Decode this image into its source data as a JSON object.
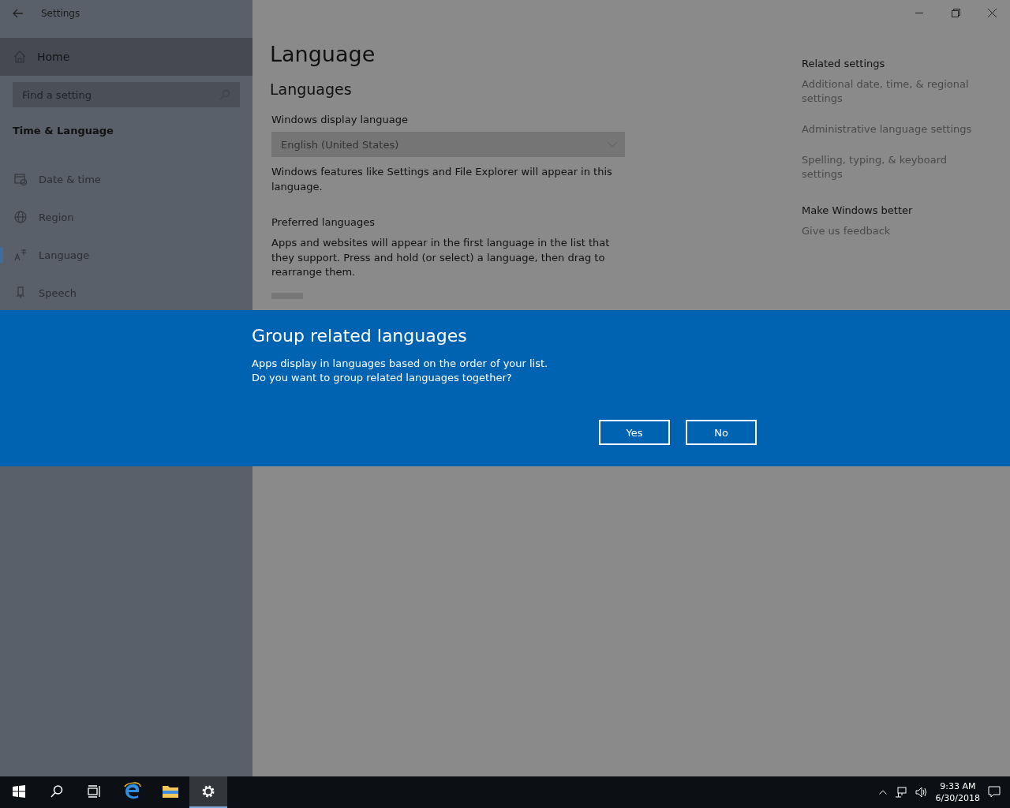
{
  "window": {
    "title": "Settings"
  },
  "sidebar": {
    "home": "Home",
    "search": {
      "placeholder": "Find a setting"
    },
    "section": "Time & Language",
    "items": [
      {
        "label": "Date & time",
        "selected": false
      },
      {
        "label": "Region",
        "selected": false
      },
      {
        "label": "Language",
        "selected": true
      },
      {
        "label": "Speech",
        "selected": false
      }
    ]
  },
  "content": {
    "title": "Language",
    "subtitle": "Languages",
    "display_label": "Windows display language",
    "display_value": "English (United States)",
    "display_note": "Windows features like Settings and File Explorer will appear in this language.",
    "preferred_label": "Preferred languages",
    "preferred_note": "Apps and websites will appear in the first language in the list that they support. Press and hold (or select) a language, then drag to rearrange them."
  },
  "related": [
    {
      "heading": "Related settings",
      "links": [
        "Additional date, time, & regional settings",
        "Administrative language settings",
        "Spelling, typing, & keyboard settings"
      ]
    },
    {
      "heading": "Make Windows better",
      "links": [
        "Give us feedback"
      ]
    }
  ],
  "dialog": {
    "title": "Group related languages",
    "lines": [
      "Apps display in languages based on the order of your list.",
      "Do you want to group related languages together?"
    ],
    "buttons": [
      "Yes",
      "No"
    ]
  },
  "taskbar": {
    "apps": [
      {
        "selected": false
      },
      {
        "selected": false
      },
      {
        "selected": false
      },
      {
        "selected": false
      },
      {
        "selected": false
      },
      {
        "selected": true
      }
    ],
    "time": "9:33 AM",
    "date": "6/30/2018"
  }
}
